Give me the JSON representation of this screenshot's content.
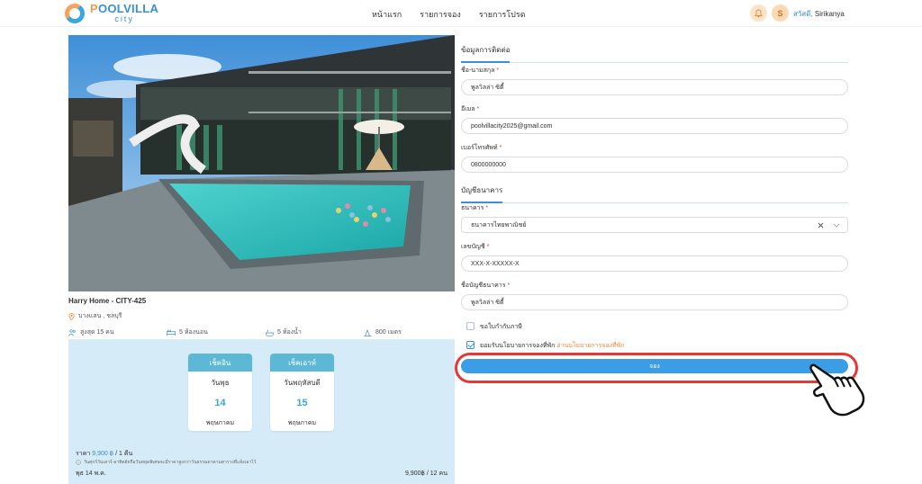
{
  "header": {
    "logo": {
      "top_accent": "P",
      "top_rest": "OOLVILLA",
      "bottom": "city"
    },
    "nav": [
      "หน้าแรก",
      "รายการจอง",
      "รายการโปรด"
    ],
    "avatar_letter": "S",
    "greeting_hi": "สวัสดี,",
    "greeting_name": "Sirikanya"
  },
  "property": {
    "name": "Harry Home - CITY-425",
    "location": "บางแสน , ชลบุรี",
    "amenities": {
      "guests": "สูงสุด 15 คน",
      "bedrooms": "5 ห้องนอน",
      "bathrooms": "5 ห้องน้ำ",
      "distance": "800 เมตร"
    }
  },
  "booking": {
    "checkin": {
      "label": "เช็คอิน",
      "day": "วันพุธ",
      "date": "14",
      "month": "พฤษภาคม"
    },
    "checkout": {
      "label": "เช็คเอาท์",
      "day": "วันพฤหัสบดี",
      "date": "15",
      "month": "พฤษภาคม"
    },
    "price_prefix": "ราคา",
    "price_value": "9,900 ฿",
    "price_suffix": "/ 1 คืน",
    "note": "วันศุกร์วันเสาร์-อาทิตย์หรือวันหยุดพิเศษจะมีราคาสูงกว่าวันธรรมดาตามตารางที่แจ้งเอาไว้",
    "summary_left": "พุธ 14 พ.ค.",
    "summary_right": "9,900฿ / 12 คน"
  },
  "form": {
    "contact_title": "ข้อมูลการติดต่อ",
    "name_label": "ชื่อ-นามสกุล",
    "name_value": "พูลวิลล่า ซิตี้",
    "email_label": "อีเมล",
    "email_value": "poolvillacity2025@gmail.com",
    "phone_label": "เบอร์โทรศัพท์",
    "phone_value": "0800000000",
    "bank_title": "บัญชีธนาคาร",
    "bank_label": "ธนาคาร",
    "bank_value": "ธนาคารไทยพาณิชย์",
    "account_label": "เลขบัญชี",
    "account_value": "XXX-X-XXXXX-X",
    "account_name_label": "ชื่อบัญชีธนาคาร",
    "account_name_value": "พูลวิลล่า ซิตี้",
    "tax_invoice_label": "ขอใบกำกับภาษี",
    "policy_label": "ยอมรับนโยบายการจองที่พัก",
    "policy_link": "อ่านนโยบายการจองที่พัก",
    "submit_label": "จอง"
  },
  "colors": {
    "accent": "#3a9de6",
    "highlight": "#e53935",
    "booking_bg": "#d6ebf8",
    "link_orange": "#f08a3a"
  }
}
